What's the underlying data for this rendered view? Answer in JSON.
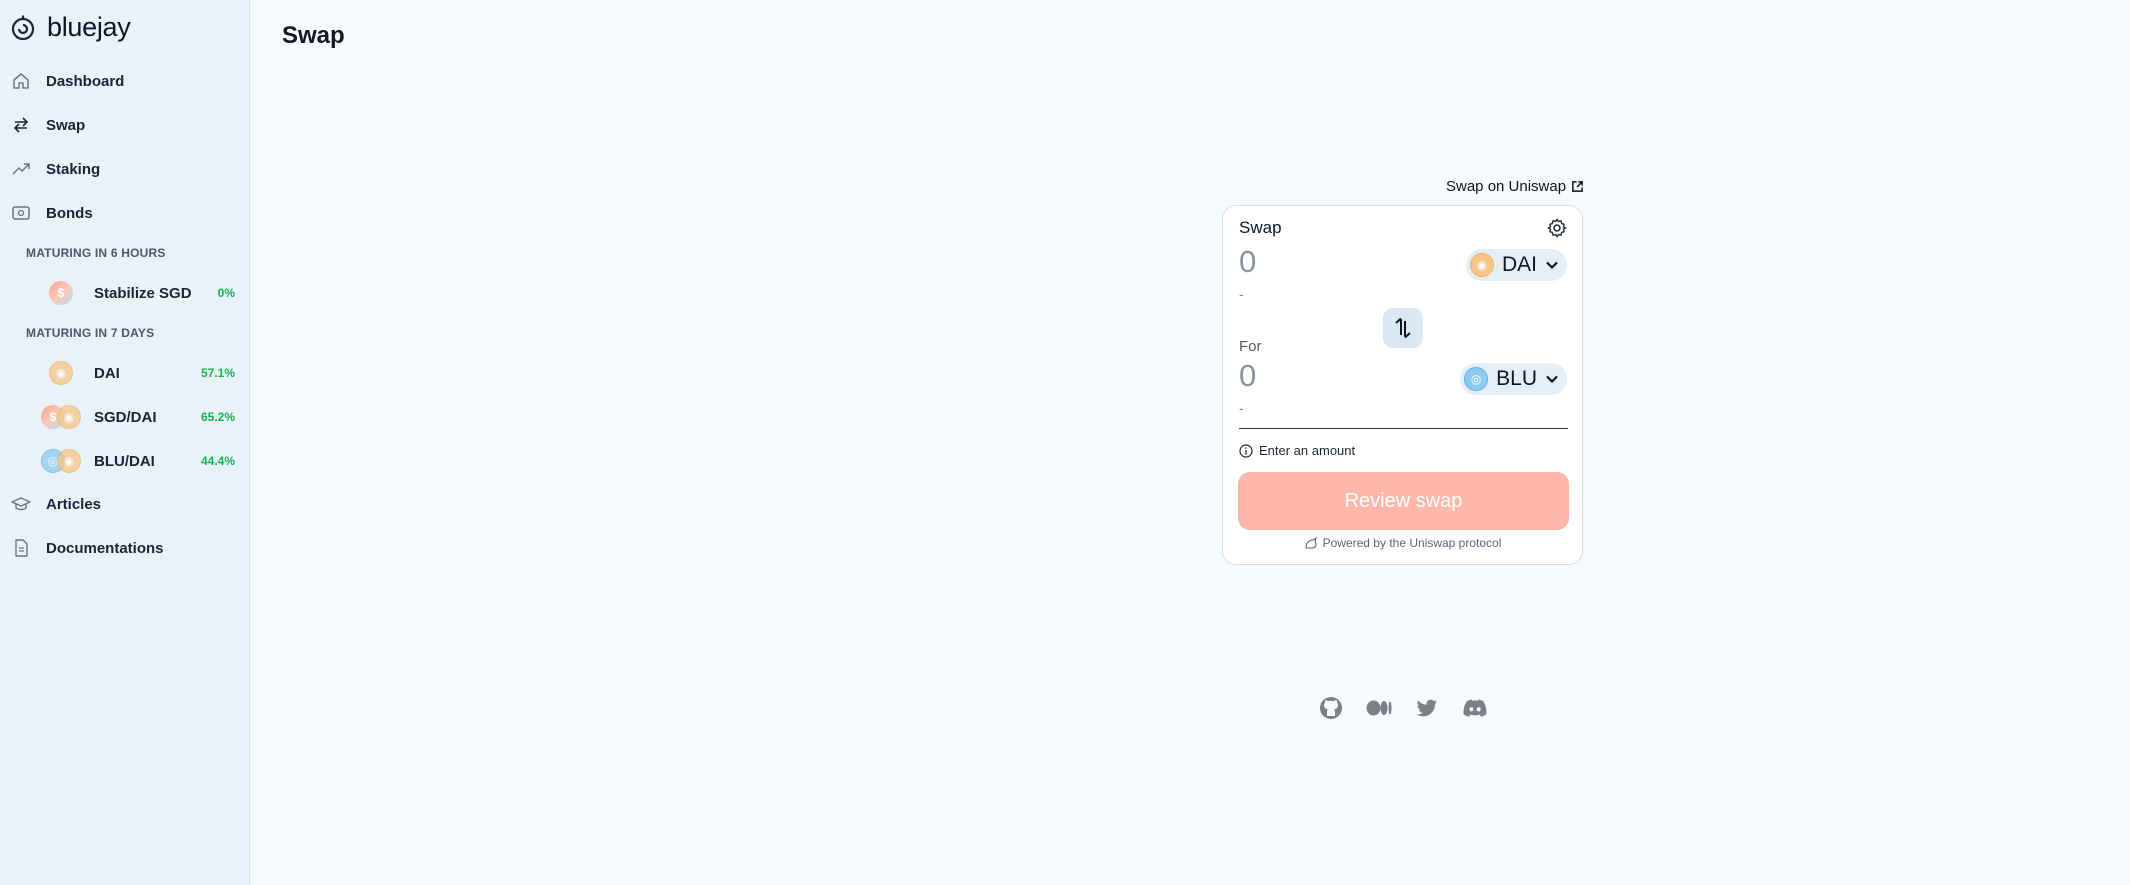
{
  "brand": {
    "name": "bluejay"
  },
  "nav": {
    "dashboard": "Dashboard",
    "swap": "Swap",
    "staking": "Staking",
    "bonds": "Bonds",
    "articles": "Articles",
    "documentations": "Documentations"
  },
  "bond_sections": [
    {
      "heading": "MATURING IN 6 HOURS",
      "items": [
        {
          "name": "Stabilize SGD",
          "apy": "0%"
        }
      ]
    },
    {
      "heading": "MATURING IN 7 DAYS",
      "items": [
        {
          "name": "DAI",
          "apy": "57.1%"
        },
        {
          "name": "SGD/DAI",
          "apy": "65.2%"
        },
        {
          "name": "BLU/DAI",
          "apy": "44.4%"
        }
      ]
    }
  ],
  "page": {
    "title": "Swap"
  },
  "swap_widget": {
    "uniswap_link": "Swap on Uniswap",
    "header": "Swap",
    "input": {
      "placeholder": "0",
      "token": "DAI",
      "usd": "-"
    },
    "output_label": "For",
    "output": {
      "placeholder": "0",
      "token": "BLU",
      "usd": "-"
    },
    "hint": "Enter an amount",
    "review_button": "Review swap",
    "powered_by": "Powered by the Uniswap protocol"
  },
  "colors": {
    "sidebar_bg": "#e9f2f9",
    "page_bg": "#f6fafd",
    "apy_green": "#15b34a",
    "review_button": "#fcb7a8",
    "token_pill": "#e4eef7"
  },
  "footer": {
    "icons": [
      "github-icon",
      "medium-icon",
      "twitter-icon",
      "discord-icon"
    ]
  }
}
